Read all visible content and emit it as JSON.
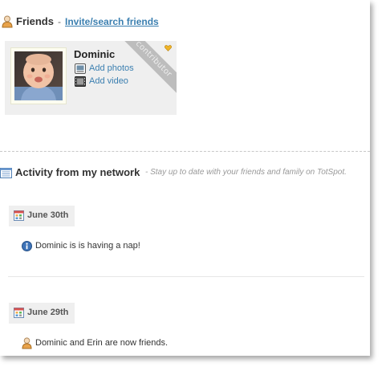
{
  "friends": {
    "title": "Friends",
    "separator": "-",
    "invite_link": "Invite/search friends",
    "cards": [
      {
        "name": "Dominic",
        "ribbon": "contributor",
        "actions": [
          {
            "label": "Add photos",
            "icon": "photo-icon"
          },
          {
            "label": "Add video",
            "icon": "video-icon"
          }
        ]
      }
    ]
  },
  "activity": {
    "title": "Activity from my network",
    "subtitle": "- Stay up to date with your friends and family on TotSpot.",
    "days": [
      {
        "date": "June 30th",
        "items": [
          {
            "icon": "info-icon",
            "text": "Dominic is is having a nap!"
          }
        ]
      },
      {
        "date": "June 29th",
        "items": [
          {
            "icon": "person-icon",
            "text": "Dominic and Erin are now friends."
          }
        ]
      }
    ]
  },
  "colors": {
    "link": "#3b7fb0",
    "card_bg": "#efefef",
    "ribbon": "#bdbdbd"
  }
}
